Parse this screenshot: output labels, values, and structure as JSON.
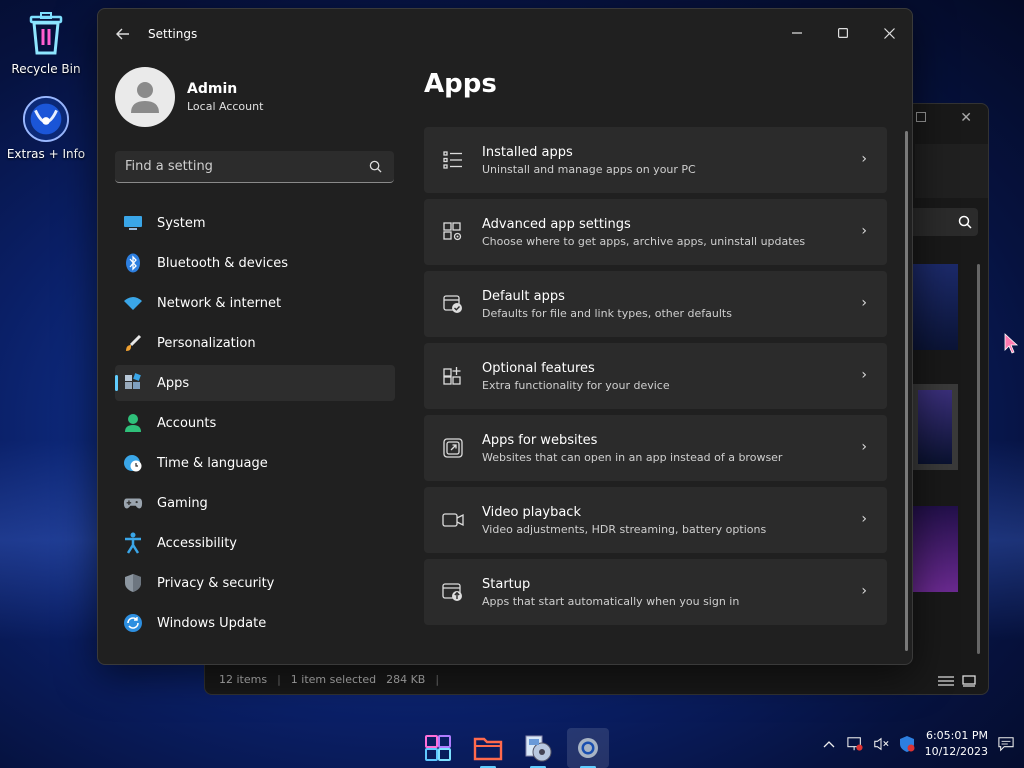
{
  "desktop": {
    "icons": [
      {
        "label": "Recycle Bin"
      },
      {
        "label": "Extras + Info"
      }
    ]
  },
  "explorer": {
    "status": {
      "items": "12 items",
      "selected": "1 item selected",
      "size": "284 KB"
    }
  },
  "settings": {
    "window_title": "Settings",
    "profile": {
      "name": "Admin",
      "type": "Local Account"
    },
    "search_placeholder": "Find a setting",
    "nav": [
      {
        "label": "System",
        "icon": "monitor-icon"
      },
      {
        "label": "Bluetooth & devices",
        "icon": "bluetooth-icon"
      },
      {
        "label": "Network & internet",
        "icon": "wifi-icon"
      },
      {
        "label": "Personalization",
        "icon": "brush-icon"
      },
      {
        "label": "Apps",
        "icon": "apps-icon",
        "active": true
      },
      {
        "label": "Accounts",
        "icon": "person-icon"
      },
      {
        "label": "Time & language",
        "icon": "globe-clock-icon"
      },
      {
        "label": "Gaming",
        "icon": "gamepad-icon"
      },
      {
        "label": "Accessibility",
        "icon": "accessibility-icon"
      },
      {
        "label": "Privacy & security",
        "icon": "shield-icon"
      },
      {
        "label": "Windows Update",
        "icon": "update-icon"
      }
    ],
    "page_title": "Apps",
    "cards": [
      {
        "title": "Installed apps",
        "subtitle": "Uninstall and manage apps on your PC",
        "icon": "list-icon"
      },
      {
        "title": "Advanced app settings",
        "subtitle": "Choose where to get apps, archive apps, uninstall updates",
        "icon": "app-settings-icon"
      },
      {
        "title": "Default apps",
        "subtitle": "Defaults for file and link types, other defaults",
        "icon": "default-apps-icon"
      },
      {
        "title": "Optional features",
        "subtitle": "Extra functionality for your device",
        "icon": "add-feature-icon"
      },
      {
        "title": "Apps for websites",
        "subtitle": "Websites that can open in an app instead of a browser",
        "icon": "open-external-icon"
      },
      {
        "title": "Video playback",
        "subtitle": "Video adjustments, HDR streaming, battery options",
        "icon": "video-icon"
      },
      {
        "title": "Startup",
        "subtitle": "Apps that start automatically when you sign in",
        "icon": "startup-icon"
      }
    ]
  },
  "taskbar": {
    "apps": [
      "start-icon",
      "file-explorer-icon",
      "media-icon",
      "settings-icon"
    ],
    "clock": {
      "time": "6:05:01 PM",
      "date": "10/12/2023"
    }
  },
  "colors": {
    "accent": "#60cdff",
    "window_bg": "#202020",
    "card_bg": "#2b2b2b"
  }
}
